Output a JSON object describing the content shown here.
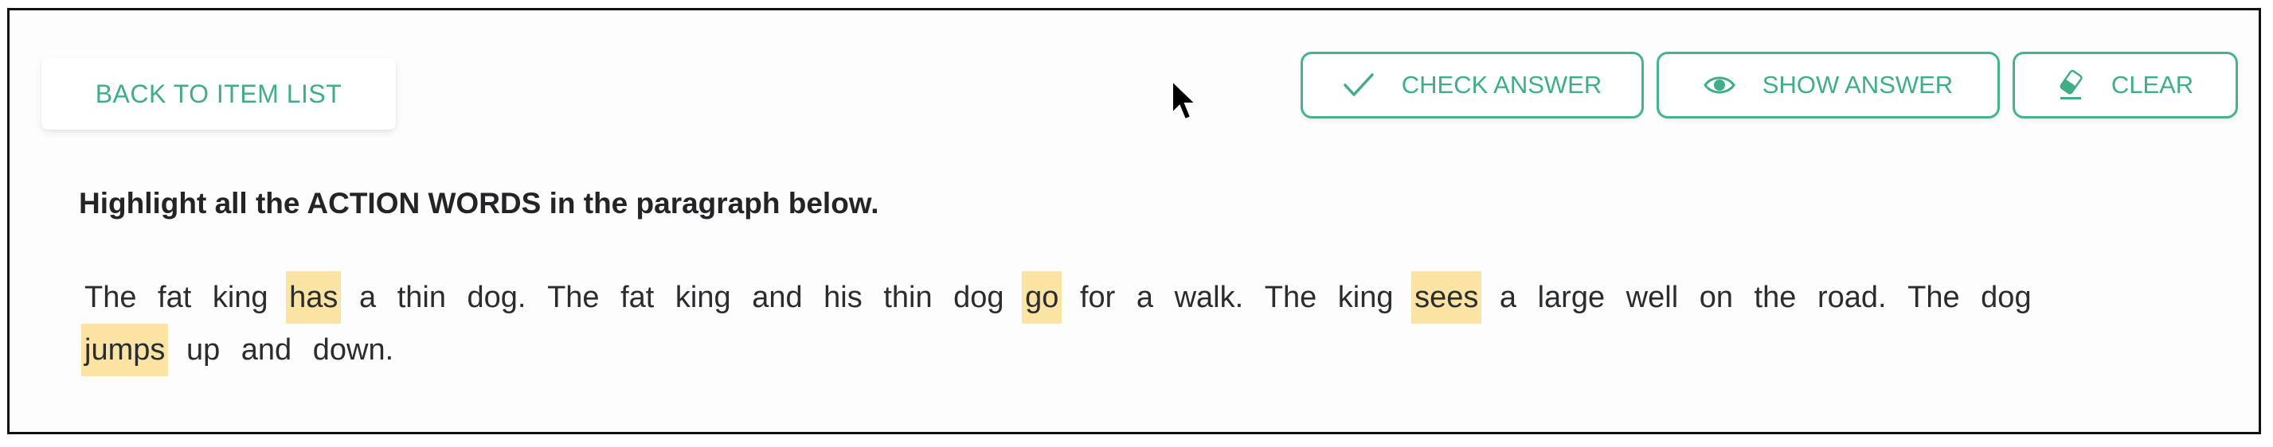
{
  "toolbar": {
    "back_label": "BACK TO ITEM LIST",
    "check_label": "CHECK ANSWER",
    "show_label": "SHOW ANSWER",
    "clear_label": "CLEAR",
    "check_icon": "checkmark-icon",
    "show_icon": "eye-icon",
    "clear_icon": "eraser-icon"
  },
  "exercise": {
    "instruction": "Highlight all the ACTION WORDS in the paragraph below.",
    "words": [
      {
        "text": "The",
        "highlighted": false
      },
      {
        "text": "fat",
        "highlighted": false
      },
      {
        "text": "king",
        "highlighted": false
      },
      {
        "text": "has",
        "highlighted": true
      },
      {
        "text": "a",
        "highlighted": false
      },
      {
        "text": "thin",
        "highlighted": false
      },
      {
        "text": "dog.",
        "highlighted": false
      },
      {
        "text": "The",
        "highlighted": false
      },
      {
        "text": "fat",
        "highlighted": false
      },
      {
        "text": "king",
        "highlighted": false
      },
      {
        "text": "and",
        "highlighted": false
      },
      {
        "text": "his",
        "highlighted": false
      },
      {
        "text": "thin",
        "highlighted": false
      },
      {
        "text": "dog",
        "highlighted": false
      },
      {
        "text": "go",
        "highlighted": true
      },
      {
        "text": "for",
        "highlighted": false
      },
      {
        "text": "a",
        "highlighted": false
      },
      {
        "text": "walk.",
        "highlighted": false
      },
      {
        "text": "The",
        "highlighted": false
      },
      {
        "text": "king",
        "highlighted": false
      },
      {
        "text": "sees",
        "highlighted": true
      },
      {
        "text": "a",
        "highlighted": false
      },
      {
        "text": "large",
        "highlighted": false
      },
      {
        "text": "well",
        "highlighted": false
      },
      {
        "text": "on",
        "highlighted": false
      },
      {
        "text": "the",
        "highlighted": false
      },
      {
        "text": "road.",
        "highlighted": false
      },
      {
        "text": "The",
        "highlighted": false
      },
      {
        "text": "dog",
        "highlighted": false
      },
      {
        "text": "jumps",
        "highlighted": true
      },
      {
        "text": "up",
        "highlighted": false
      },
      {
        "text": "and",
        "highlighted": false
      },
      {
        "text": "down.",
        "highlighted": false
      }
    ]
  },
  "colors": {
    "accent": "#3fae87",
    "highlight": "#fbe3a3",
    "text": "#2a2c30"
  }
}
